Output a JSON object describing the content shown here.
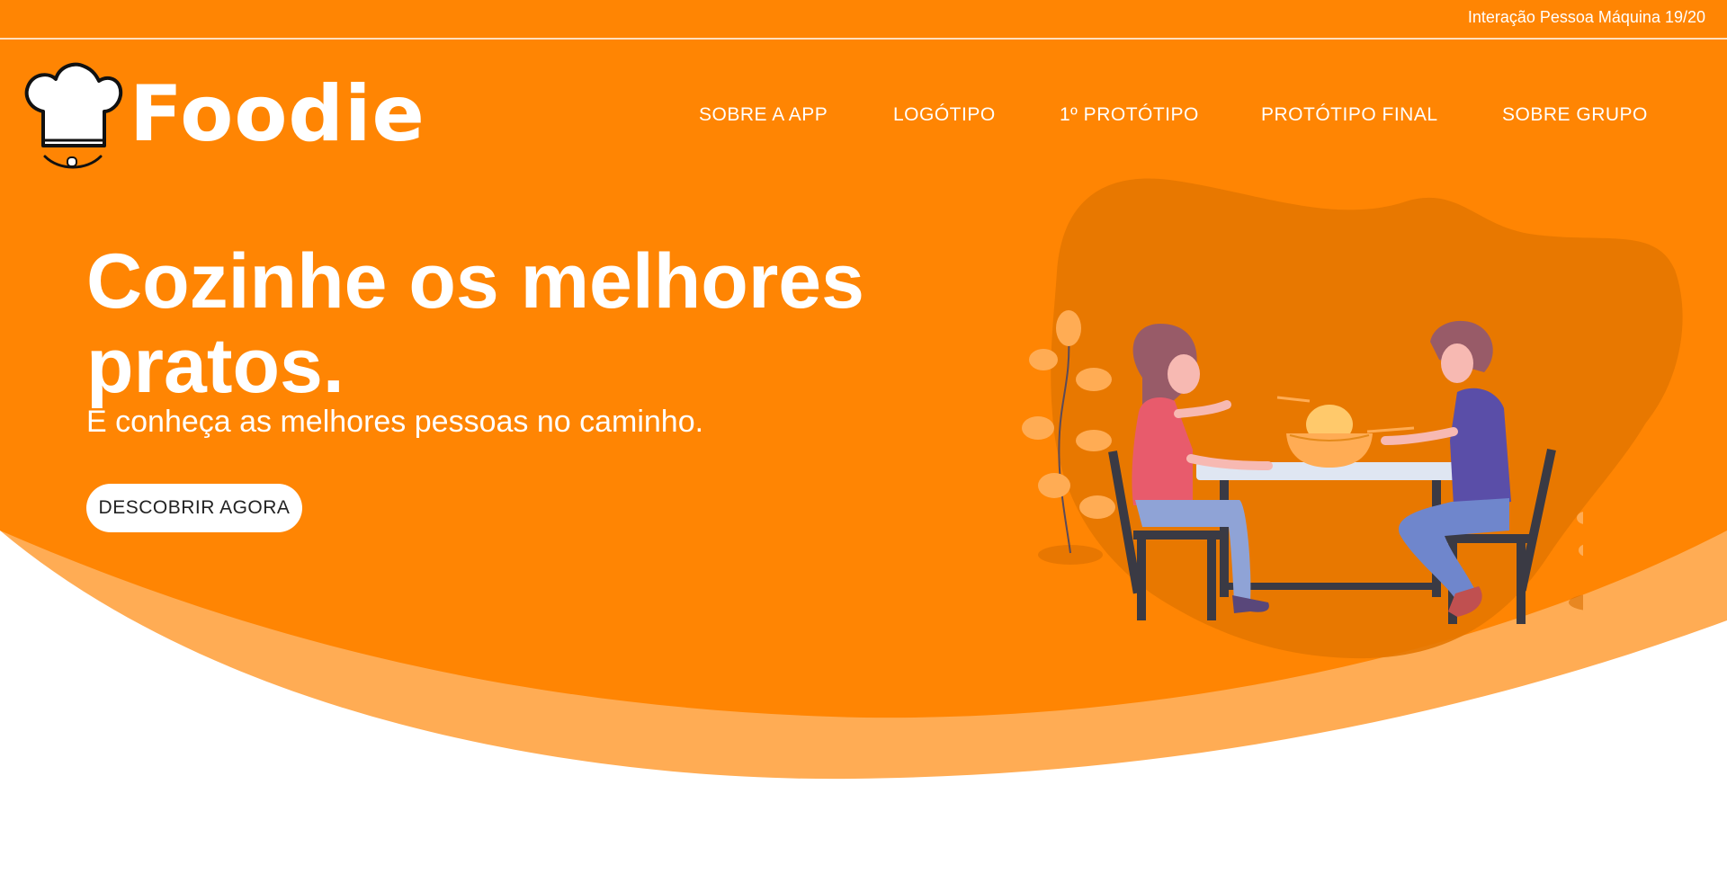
{
  "colors": {
    "primary": "#ff8503",
    "wave_light": "#ffac54",
    "blob": "#e57700",
    "white": "#ffffff"
  },
  "header": {
    "course_label": "Interação Pessoa Máquina 19/20"
  },
  "brand": {
    "name": "Foodie",
    "icon": "chef-hat-icon"
  },
  "nav": {
    "items": [
      {
        "label": "SOBRE A APP"
      },
      {
        "label": "LOGÓTIPO"
      },
      {
        "label": "1º PROTÓTIPO"
      },
      {
        "label": "PROTÓTIPO FINAL"
      },
      {
        "label": "SOBRE GRUPO"
      }
    ]
  },
  "hero": {
    "title_line1": "Cozinhe os melhores",
    "title_line2": "pratos.",
    "subtitle": "E conheça as melhores pessoas no caminho.",
    "cta_label": "DESCOBRIR AGORA",
    "illustration": "couple-eating-noodles-illustration"
  }
}
